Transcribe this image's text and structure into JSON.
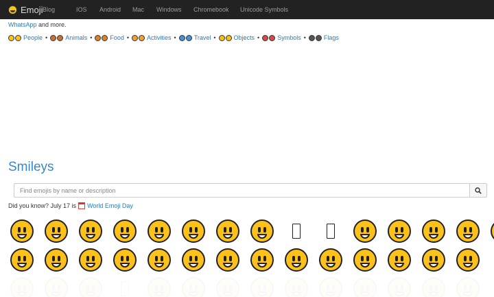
{
  "navbar": {
    "brand": "Emoji",
    "links": [
      "Blog",
      "IOS",
      "Android",
      "Mac",
      "Windows",
      "Chromebook",
      "Unicode Symbols"
    ]
  },
  "intro": {
    "link": "WhatsApp",
    "rest": " and more."
  },
  "categories": [
    "People",
    "Animals",
    "Food",
    "Activities",
    "Travel",
    "Objects",
    "Symbols",
    "Flags"
  ],
  "category_colors": [
    "#f5c518",
    "#c8703a",
    "#d9822b",
    "#f0a030",
    "#4a8fd0",
    "#f0c020",
    "#d84a4a",
    "#555555"
  ],
  "section": {
    "heading": "Smileys"
  },
  "search": {
    "placeholder": "Find emojis by name or description"
  },
  "did_you_know": {
    "prefix": "Did you know? July 17 is ",
    "link": "World Emoji Day"
  },
  "colors": {
    "accent": "#2a7ac0",
    "heading": "#3a87c8",
    "navbar": "#222222",
    "emoji": "#fcc21b"
  },
  "emoji_rows": [
    [
      "grinning-face",
      "grinning-face-big-eyes",
      "grinning-face-smiling-eyes",
      "beaming-face",
      "squinting-face",
      "grinning-face-sweat",
      "face-tears-of-joy",
      "rolling-on-floor-laughing",
      "missing-glyph",
      "missing-glyph",
      "smiling-face",
      "smiling-face-smiling-eyes",
      "smiling-face-halo",
      "slightly-smiling-face",
      "upside-down-face"
    ],
    [
      "winking-face",
      "relieved-face",
      "heart-eyes-face",
      "smiling-face-hearts",
      "face-blowing-kiss",
      "kissing-face",
      "kissing-face-smiling-eyes",
      "kissing-face-closed-eyes",
      "face-savoring-food",
      "face-tongue",
      "squinting-face-tongue",
      "winking-face-tongue",
      "star-struck",
      "face-raised-eyebrow"
    ],
    [
      "nerd-face",
      "monocle-face",
      "smiling-face-sunglasses",
      "missing-glyph",
      "hugging-face",
      "partying-face",
      "smirking-face",
      "unamused-face",
      "disappointed-face",
      "pensive-face",
      "worried-face",
      "confused-face",
      "slightly-frowning-face",
      "frowning-face"
    ]
  ]
}
